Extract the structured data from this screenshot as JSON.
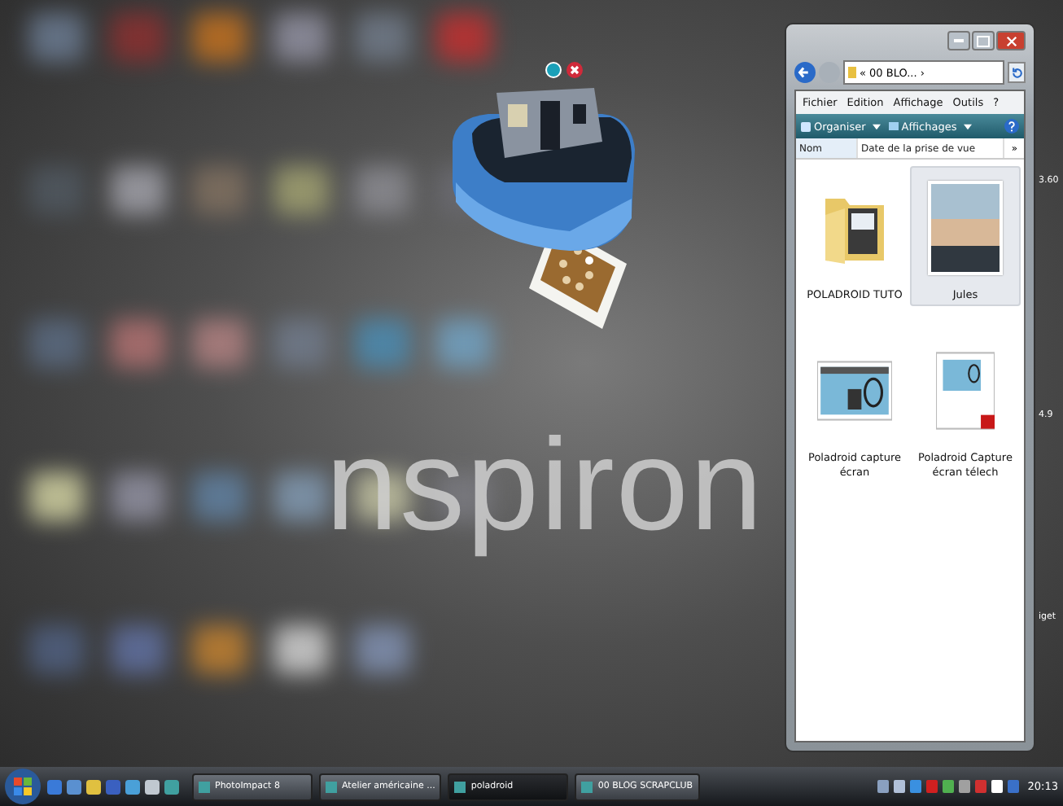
{
  "desktop": {
    "wallpaper_text": "nspiron",
    "icon_labels": [
      "3.60",
      "4.9",
      "iget"
    ]
  },
  "explorer": {
    "address": "« 00 BLO... ›",
    "menu": [
      "Fichier",
      "Edition",
      "Affichage",
      "Outils",
      "?"
    ],
    "toolbar": [
      "Organiser",
      "Affichages"
    ],
    "columns": [
      "Nom",
      "Date de la prise de vue"
    ],
    "more_columns": "»",
    "items": [
      {
        "name": "POLADROID TUTO",
        "kind": "folder",
        "selected": false
      },
      {
        "name": "Jules",
        "kind": "photo",
        "selected": true
      },
      {
        "name": "Poladroid capture écran",
        "kind": "screenshot",
        "selected": false
      },
      {
        "name": "Poladroid Capture écran télech",
        "kind": "pdf",
        "selected": false
      }
    ]
  },
  "taskbar": {
    "tasks": [
      {
        "label": "PhotoImpact 8",
        "selected": false
      },
      {
        "label": "Atelier américaine ...",
        "selected": false
      },
      {
        "label": "poladroid",
        "selected": true
      },
      {
        "label": "00 BLOG SCRAPCLUB",
        "selected": false
      }
    ],
    "clock": "20:13"
  }
}
